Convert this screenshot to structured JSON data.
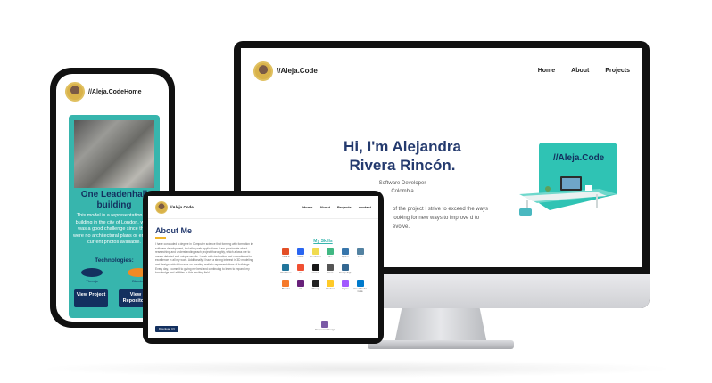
{
  "desktop": {
    "brand": "//Aleja.Code",
    "nav": [
      "Home",
      "About",
      "Projects"
    ],
    "hero_title": "Hi, I'm Alejandra Rivera Rincón.",
    "hero_role": "Software Developer",
    "hero_location": "Colombia",
    "paragraph": "of the project I strive to exceed the ways looking for new ways to improve d to evolve.",
    "illustration_label": "//Aleja.Code"
  },
  "phone": {
    "brand": "//Aleja.CodeHome",
    "project_title": "One Leadenhall building",
    "project_text": "This model is a representation of a building in the city of London, which was a good challenge since there were no architectural plans or enough current photos available.",
    "technologies_label": "Technologies:",
    "tools": [
      "Threejs",
      "Blender"
    ],
    "view_project": "View Project",
    "view_repository": "View Repository"
  },
  "tablet": {
    "brand": "//Aleja.Code",
    "nav": [
      "Home",
      "About",
      "Projects",
      "contact"
    ],
    "about_title": "About Me",
    "about_text": "I have concluded a degree in Computer science that forming with formation in software development, including web applications. I am passionate about researching and understanding each project thoroughly, which allows me to create detailed and unique results. I work with dedication and commitment to excellence in all my work. Additionally, I have a strong interest in 3D modeling and design, which focuses on creating realistic representations of buildings. Every day, I commit to giving my best and continuing to learn to expand my knowledge and abilities in this exciting field.",
    "download_cv": "Download CV",
    "skills_title": "My Skills",
    "skills": [
      "HTML5",
      "CSS3",
      "JavaScript",
      "Vue",
      "Python",
      "Java",
      "WordPress",
      "Git",
      "GitHub",
      "Flask",
      "PostgreSQL",
      "",
      "Blender",
      "C#",
      "Threejs",
      "Firebase",
      "Figma",
      "Visual Studio Code"
    ],
    "last_skill": "Responsive Design"
  },
  "colors": {
    "navy": "#243a6e",
    "teal": "#37b5ad",
    "accent": "#f0b429"
  }
}
